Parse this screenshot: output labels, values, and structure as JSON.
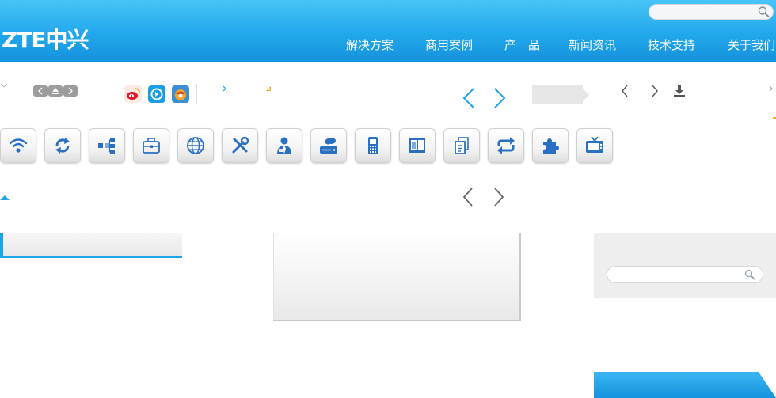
{
  "header": {
    "logo_text": "ZTE中兴",
    "search": {
      "placeholder": "",
      "value": ""
    },
    "nav": [
      {
        "label": "解决方案"
      },
      {
        "label": "商用案例"
      },
      {
        "label": "产　品"
      },
      {
        "label": "新闻资讯"
      },
      {
        "label": "技术支持"
      },
      {
        "label": "关于我们"
      }
    ]
  },
  "toolbar": {
    "social": [
      {
        "name": "weibo-icon",
        "color": "#e6162d"
      },
      {
        "name": "qzone-icon",
        "color": "#1a9ee6"
      },
      {
        "name": "share-icon",
        "color": "#f5a623"
      }
    ]
  },
  "sidebar_search": {
    "placeholder": "",
    "value": ""
  },
  "icon_tiles": [
    "wifi-icon",
    "refresh-icon",
    "network-tree-icon",
    "briefcase-icon",
    "globe-icon",
    "tools-icon",
    "user-agent-icon",
    "cloud-storage-icon",
    "mobile-phone-icon",
    "book-icon",
    "documents-icon",
    "sync-icon",
    "puzzle-icon",
    "tv-icon"
  ],
  "colors": {
    "brand": "#1fa2e8",
    "icon_blue": "#2a70c2"
  }
}
